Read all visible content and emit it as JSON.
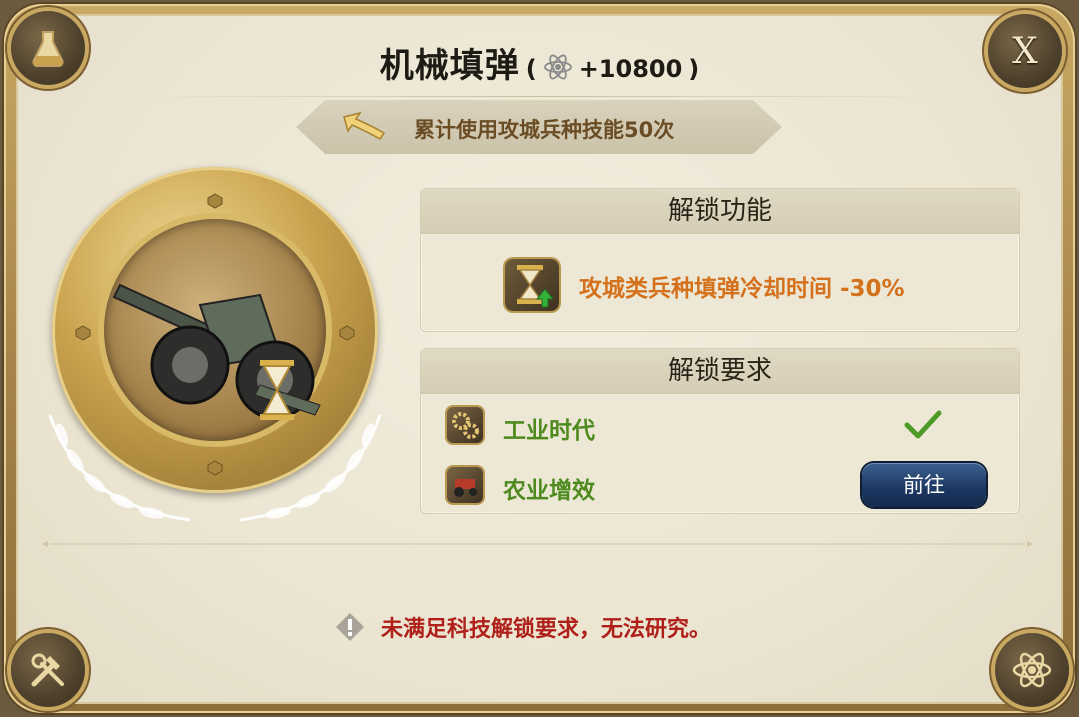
{
  "title": {
    "name": "机械填弹",
    "paren_open": "(",
    "reward_value": "+10800",
    "paren_close": ")",
    "reward_icon": "atom-icon"
  },
  "hint": {
    "text": "累计使用攻城兵种技能50次",
    "icon": "arrow-icon"
  },
  "unlock_feature": {
    "header": "解锁功能",
    "effect": "攻城类兵种填弹冷却时间 -30%",
    "icon": "hourglass-upgrade-icon"
  },
  "unlock_requirements": {
    "header": "解锁要求",
    "items": [
      {
        "label": "工业时代",
        "status": "completed",
        "icon": "gears-icon"
      },
      {
        "label": "农业增效",
        "status": "incomplete",
        "icon": "tractor-icon",
        "action_label": "前往"
      }
    ]
  },
  "warning": {
    "text": "未满足科技解锁要求，无法研究。",
    "icon": "warning-icon"
  },
  "corners": {
    "top_left": "flask-icon",
    "top_right": "X",
    "bottom_left": "tools-icon",
    "bottom_right": "atom-icon"
  },
  "colors": {
    "effect_text": "#d4711c",
    "requirement_text": "#4e8a1e",
    "warning_text": "#b0201a",
    "button_bg": "#1c3760"
  }
}
